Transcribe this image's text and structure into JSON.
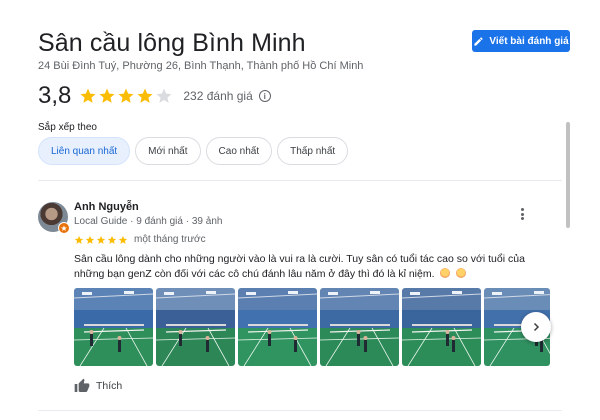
{
  "place": {
    "name": "Sân cầu lông Bình Minh",
    "address": "24 Bùi Đình Tuý, Phường 26, Bình Thạnh, Thành phố Hồ Chí Minh"
  },
  "write_review": {
    "label": "Viết bài đánh giá",
    "icon": "pencil-icon"
  },
  "rating": {
    "value": "3,8",
    "stars_filled": 3.8,
    "stars_total": 5,
    "count_text": "232 đánh giá",
    "info_icon": "info-icon"
  },
  "sort": {
    "label": "Sắp xếp theo",
    "options": [
      {
        "label": "Liên quan nhất",
        "selected": true
      },
      {
        "label": "Mới nhất",
        "selected": false
      },
      {
        "label": "Cao nhất",
        "selected": false
      },
      {
        "label": "Thấp nhất",
        "selected": false
      }
    ]
  },
  "review": {
    "author": "Anh Nguyễn",
    "meta": "Local Guide · 9 đánh giá · 39 ảnh",
    "stars": 5,
    "time": "một tháng trước",
    "text": "Sân cầu lông dành cho những người vào là vui ra là cười. Tuy sân có tuổi tác cao so với tuổi của những bạn genZ còn đối với các cô chú đánh lâu năm ở đây thì đó là kỉ niệm.",
    "emojis": [
      "smiling-face-emoji",
      "smiling-face-emoji"
    ],
    "photo_count_visible": 6,
    "like_label": "Thích"
  },
  "colors": {
    "accent": "#1a73e8",
    "star": "#fbbc04",
    "star_empty": "#dadce0",
    "chip_active_bg": "#e8f0fe",
    "chip_active_text": "#1967d2",
    "court_green": "#2e8b57"
  }
}
